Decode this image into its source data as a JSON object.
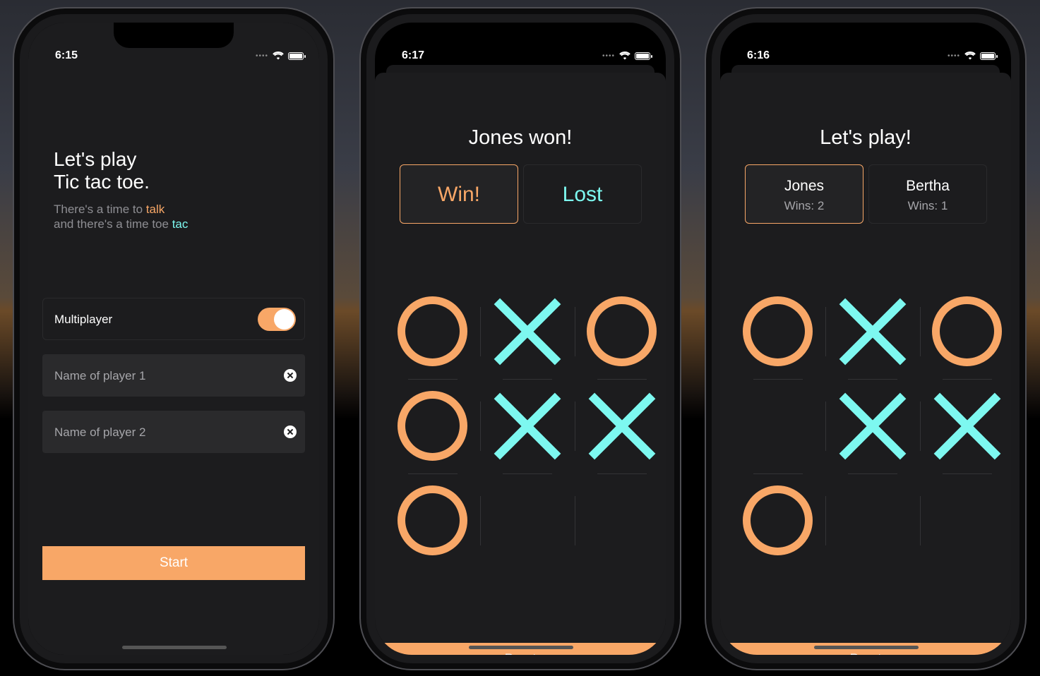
{
  "screens": [
    {
      "time": "6:15",
      "title_line1": "Let's play",
      "title_line2": "Tic tac toe.",
      "subtitle_part1": "There's a time to ",
      "subtitle_accent1": "talk",
      "subtitle_part2": "and there's a time toe ",
      "subtitle_accent2": "tac",
      "multiplayer_label": "Multiplayer",
      "multiplayer_on": true,
      "player1_placeholder": "Name of player 1",
      "player2_placeholder": "Name of player 2",
      "start_label": "Start"
    },
    {
      "time": "6:17",
      "heading": "Jones won!",
      "card_left": "Win!",
      "card_right": "Lost",
      "board": [
        "O",
        "X",
        "O",
        "O",
        "X",
        "X",
        "O",
        "",
        ""
      ],
      "reset_label": "Reset"
    },
    {
      "time": "6:16",
      "heading": "Let's play!",
      "player_left": {
        "name": "Jones",
        "wins": "Wins: 2"
      },
      "player_right": {
        "name": "Bertha",
        "wins": "Wins: 1"
      },
      "board": [
        "O",
        "X",
        "O",
        "",
        "X",
        "X",
        "O",
        "",
        ""
      ],
      "reset_label": "Reset"
    }
  ],
  "colors": {
    "orange": "#f8a767",
    "cyan": "#7df8f0",
    "background": "#1c1c1e"
  }
}
